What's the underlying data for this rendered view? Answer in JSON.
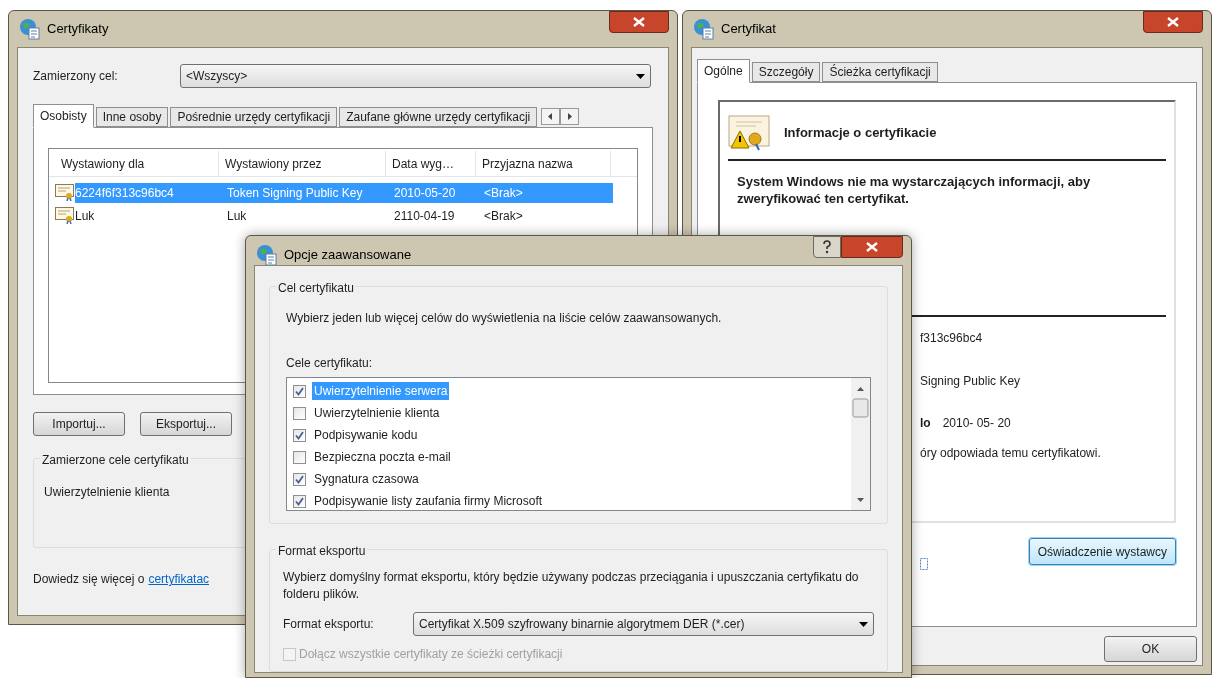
{
  "certificates_window": {
    "title": "Certyfikaty",
    "purpose_label": "Zamierzony cel:",
    "purpose_value": "<Wszyscy>",
    "tabs": [
      {
        "label": "Osobisty",
        "selected": true
      },
      {
        "label": "Inne osoby",
        "selected": false
      },
      {
        "label": "Pośrednie urzędy certyfikacji",
        "selected": false
      },
      {
        "label": "Zaufane główne urzędy certyfikacji",
        "selected": false
      }
    ],
    "columns": [
      "Wystawiony dla",
      "Wystawiony przez",
      "Data wyg…",
      "Przyjazna nazwa"
    ],
    "rows": [
      {
        "cells": [
          "6224f6f313c96bc4",
          "Token Signing Public Key",
          "2010-05-20",
          "<Brak>"
        ],
        "selected": true
      },
      {
        "cells": [
          "Luk",
          "Luk",
          "2110-04-19",
          "<Brak>"
        ],
        "selected": false
      }
    ],
    "buttons": [
      "Importuj...",
      "Eksportuj..."
    ],
    "purposes_group": {
      "title": "Zamierzone cele certyfikatu",
      "text": "Uwierzytelnienie klienta"
    },
    "footer": {
      "text": "Dowiedz się więcej o",
      "link": "certyfikatac"
    }
  },
  "certificate_window": {
    "title": "Certyfikat",
    "tabs": [
      {
        "label": "Ogólne",
        "selected": true
      },
      {
        "label": "Szczegóły",
        "selected": false
      },
      {
        "label": "Ścieżka certyfikacji",
        "selected": false
      }
    ],
    "info_title": "Informacje o certyfikacie",
    "warning": "System Windows nie ma wystarczających informacji, aby zweryfikować ten certyfikat.",
    "fields": [
      {
        "kind": "plain",
        "text": "f313c96bc4"
      },
      {
        "kind": "plain",
        "text": "Signing Public Key"
      },
      {
        "kind": "labeled",
        "label": "lo",
        "value": "2010- 05- 20"
      },
      {
        "kind": "plain",
        "text": "óry odpowiada temu certyfikatowi."
      }
    ],
    "issuer_button": "Oświadczenie wystawcy",
    "ok_button": "OK"
  },
  "advanced_dialog": {
    "title": "Opcje zaawansowane",
    "purpose_group": {
      "title": "Cel certyfikatu",
      "description": "Wybierz jeden lub więcej celów do wyświetlenia na liście celów zaawansowanych.",
      "list_label": "Cele certyfikatu:",
      "items": [
        {
          "label": "Uwierzytelnienie serwera",
          "checked": true,
          "selected": true
        },
        {
          "label": "Uwierzytelnienie klienta",
          "checked": false,
          "selected": false
        },
        {
          "label": "Podpisywanie kodu",
          "checked": true,
          "selected": false
        },
        {
          "label": "Bezpieczna poczta e-mail",
          "checked": false,
          "selected": false
        },
        {
          "label": "Sygnatura czasowa",
          "checked": true,
          "selected": false
        },
        {
          "label": "Podpisywanie listy zaufania firmy Microsoft",
          "checked": true,
          "selected": false
        }
      ]
    },
    "export_group": {
      "title": "Format eksportu",
      "description": "Wybierz domyślny format eksportu, który będzie używany podczas przeciągania i upuszczania certyfikatu do folderu plików.",
      "format_label": "Format eksportu:",
      "format_value": "Certyfikat X.509 szyfrowany binarnie algorytmem DER (*.cer)",
      "include_all": {
        "label": "Dołącz wszystkie certyfikaty ze ścieżki certyfikacji",
        "checked": false,
        "disabled": true
      }
    }
  }
}
